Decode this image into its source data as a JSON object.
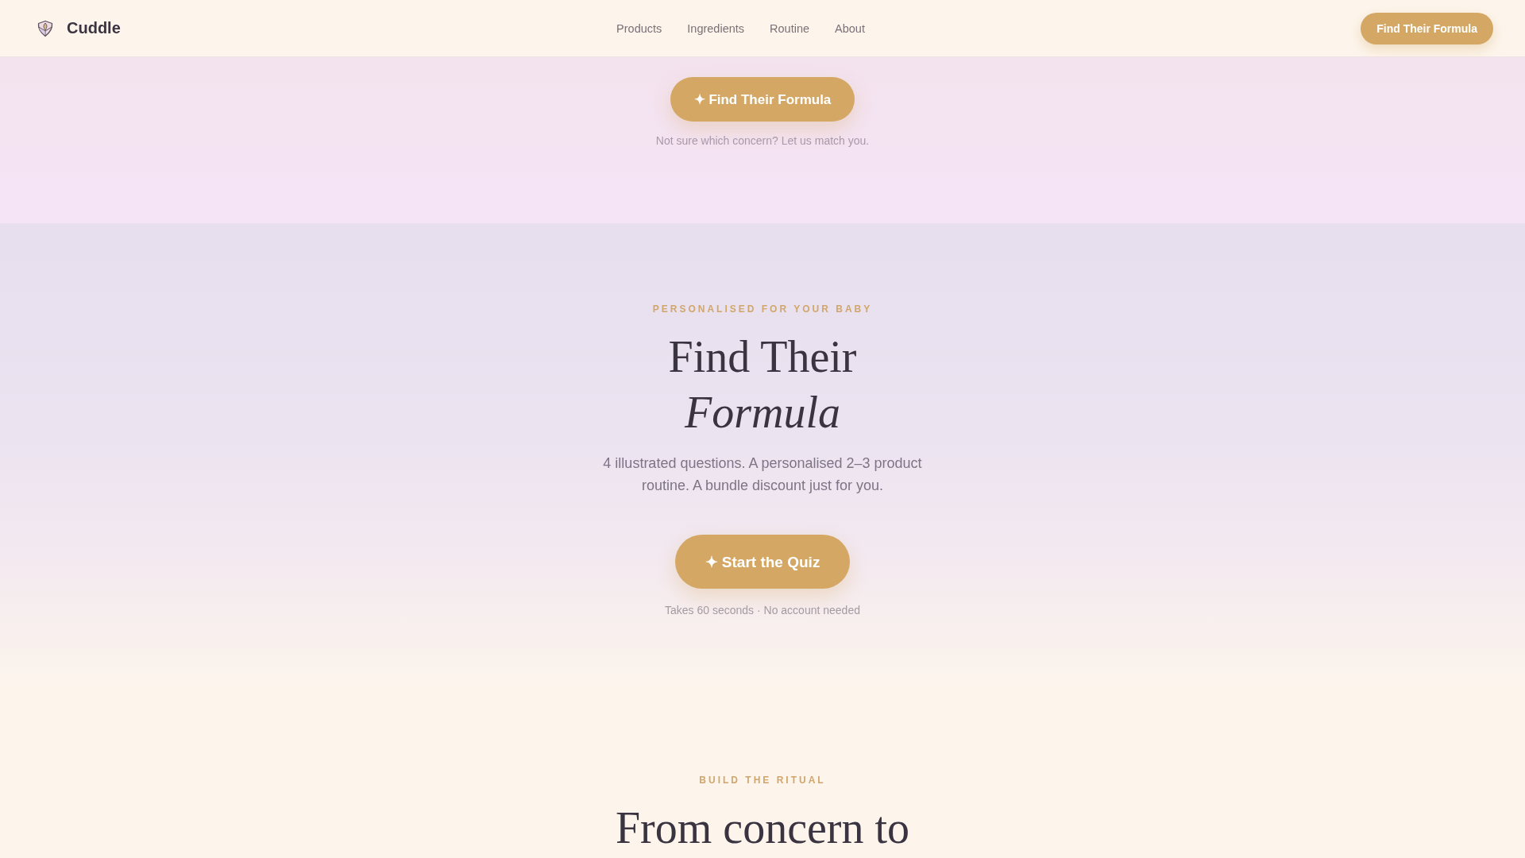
{
  "nav": {
    "brand": "Cuddle",
    "links": [
      "Products",
      "Ingredients",
      "Routine",
      "About"
    ],
    "cta": "Find Their Formula"
  },
  "match_banner": {
    "button": "✦ Find Their Formula",
    "caption": "Not sure which concern? Let us match you."
  },
  "quiz_hero": {
    "eyebrow": "PERSONALISED FOR YOUR BABY",
    "title": "Find Their *Formula*",
    "description": "4 illustrated questions. A personalised 2–3 product routine. A bundle discount just for you.",
    "button": "✦ Start the Quiz",
    "caption": "Takes 60 seconds · No account needed"
  },
  "ritual_section": {
    "eyebrow": "BUILD THE RITUAL",
    "title": "From concern to"
  }
}
